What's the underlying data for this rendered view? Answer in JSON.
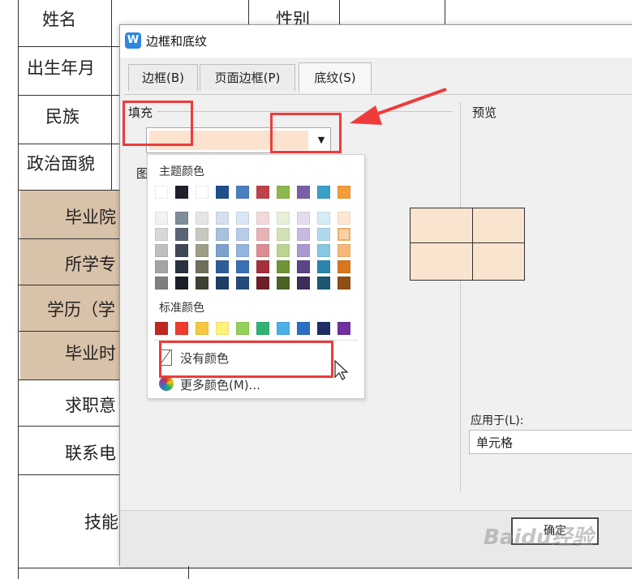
{
  "document": {
    "labels": {
      "name": "姓名",
      "gender": "性别",
      "birth": "出生年月",
      "ethnicity": "民族",
      "political": "政治面貌",
      "graduated_school": "毕业院",
      "major": "所学专",
      "education": "学历（学",
      "graduation_time": "毕业时",
      "job_intention": "求职意",
      "contact": "联系电",
      "skills": "技能"
    }
  },
  "dialog": {
    "title": "边框和底纹",
    "app_icon_letter": "W",
    "tabs": [
      {
        "label": "边框(B)",
        "active": false
      },
      {
        "label": "页面边框(P)",
        "active": false
      },
      {
        "label": "底纹(S)",
        "active": true
      }
    ],
    "fill_label": "填充",
    "fill_color": "#fbe3cf",
    "pattern_label_partial": "图",
    "preview_label": "预览",
    "apply_to_label": "应用于(L):",
    "apply_to_value": "单元格",
    "ok_label": "确定"
  },
  "color_dropdown": {
    "theme_title": "主题颜色",
    "standard_title": "标准颜色",
    "no_color": "没有颜色",
    "more_colors": "更多颜色(M)...",
    "theme_colors": [
      "#ffffff",
      "#1f1f2e",
      "#ffffff",
      "#1f4e8c",
      "#4a7fc1",
      "#c0404a",
      "#8fb84c",
      "#7a5fa8",
      "#3aa0c8",
      "#f39c3c"
    ],
    "theme_shades": [
      [
        "#f2f2f2",
        "#7f8c9a",
        "#e6e6e6",
        "#d6e0ee",
        "#dbe6f4",
        "#f4d9db",
        "#e8f0da",
        "#e3dcee",
        "#d6ecf5",
        "#fde7d2"
      ],
      [
        "#d8d8d8",
        "#5a6675",
        "#c8c8c0",
        "#a9c0de",
        "#b7cdea",
        "#e8b3b7",
        "#d2e2b6",
        "#c7badf",
        "#aedaeb",
        "#fbcfa5"
      ],
      [
        "#bfbfbf",
        "#3e4856",
        "#9e9e88",
        "#7da1cd",
        "#93b4df",
        "#dc8d93",
        "#bcd492",
        "#ab98cf",
        "#86c7e1",
        "#f8b778"
      ],
      [
        "#a5a5a5",
        "#2a323d",
        "#6f6f5c",
        "#2f5d9a",
        "#3a6fb5",
        "#a3303a",
        "#6e9536",
        "#5b4585",
        "#2a84ab",
        "#d9771f"
      ],
      [
        "#7f7f7f",
        "#1a1f27",
        "#3f3f33",
        "#1f3e67",
        "#264a79",
        "#6d2027",
        "#4a6324",
        "#3d2e59",
        "#1c5872",
        "#914f14"
      ]
    ],
    "standard_colors": [
      "#c0281f",
      "#ef3b2c",
      "#f5c842",
      "#fff27a",
      "#93d05a",
      "#2fb374",
      "#4ab0e8",
      "#2a6fc4",
      "#1f2f66",
      "#7030a0"
    ]
  },
  "watermark": "Baidu经验"
}
